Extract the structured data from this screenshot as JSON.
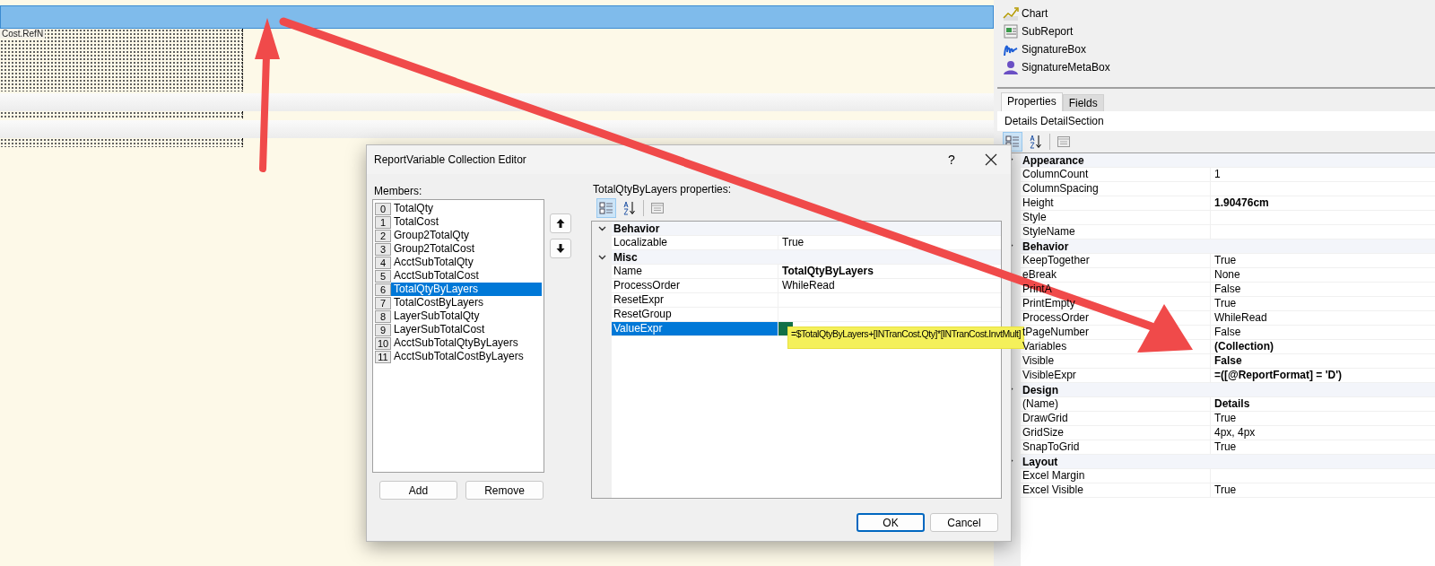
{
  "designer": {
    "sections": [
      {
        "selected": true
      },
      {
        "selected": false
      },
      {
        "selected": false
      }
    ],
    "field_label": "Cost.RefN"
  },
  "toolbox": [
    {
      "label": "Chart",
      "kind": "chart"
    },
    {
      "label": "SubReport",
      "kind": "subreport"
    },
    {
      "label": "SignatureBox",
      "kind": "signature"
    },
    {
      "label": "SignatureMetaBox",
      "kind": "person"
    }
  ],
  "properties_panel": {
    "tabs": [
      {
        "label": "Properties",
        "selected": true
      },
      {
        "label": "Fields",
        "selected": false
      }
    ],
    "object": "Details DetailSection",
    "categories": [
      {
        "name": "Appearance",
        "expanded": true,
        "properties": [
          {
            "name": "ColumnCount",
            "value": "1",
            "bold": false
          },
          {
            "name": "ColumnSpacing"
          },
          {
            "name": "Height",
            "value": "1.90476cm",
            "bold": true
          },
          {
            "name": "Style"
          },
          {
            "name": "StyleName"
          }
        ]
      },
      {
        "name": "Behavior",
        "expanded": true,
        "properties": [
          {
            "name": "KeepTogether",
            "value": "True",
            "bold": false
          },
          {
            "name": "eBreak",
            "value": "None",
            "bold": false
          },
          {
            "name": "PrintA",
            "value": "False",
            "bold": false
          },
          {
            "name": "PrintEmpty",
            "value": "True",
            "bold": false
          },
          {
            "name": "ProcessOrder",
            "value": "WhileRead",
            "bold": false
          },
          {
            "name": "tPageNumber",
            "value": "False",
            "bold": false
          },
          {
            "name": "Variables",
            "value": "(Collection)",
            "bold": true
          },
          {
            "name": "Visible",
            "value": "False",
            "bold": true
          },
          {
            "name": "VisibleExpr",
            "value": "=([@ReportFormat] = 'D')",
            "bold": true
          }
        ]
      },
      {
        "name": "Design",
        "expanded": true,
        "properties": [
          {
            "name": "(Name)",
            "value": "Details",
            "bold": true
          },
          {
            "name": "DrawGrid",
            "value": "True",
            "bold": false
          },
          {
            "name": "GridSize",
            "value": "4px, 4px",
            "bold": false
          },
          {
            "name": "SnapToGrid",
            "value": "True",
            "bold": false
          }
        ]
      },
      {
        "name": "Layout",
        "expanded": true,
        "properties": [
          {
            "name": "Excel Margin"
          },
          {
            "name": "Excel Visible",
            "value": "True",
            "bold": false
          }
        ]
      }
    ]
  },
  "dialog": {
    "title": "ReportVariable Collection Editor",
    "help": "?",
    "members_label": "Members:",
    "members": [
      {
        "index": "0",
        "name": "TotalQty",
        "selected": false
      },
      {
        "index": "1",
        "name": "TotalCost",
        "selected": false
      },
      {
        "index": "2",
        "name": "Group2TotalQty",
        "selected": false
      },
      {
        "index": "3",
        "name": "Group2TotalCost",
        "selected": false
      },
      {
        "index": "4",
        "name": "AcctSubTotalQty",
        "selected": false
      },
      {
        "index": "5",
        "name": "AcctSubTotalCost",
        "selected": false
      },
      {
        "index": "6",
        "name": "TotalQtyByLayers",
        "selected": true
      },
      {
        "index": "7",
        "name": "TotalCostByLayers",
        "selected": false
      },
      {
        "index": "8",
        "name": "LayerSubTotalQty",
        "selected": false
      },
      {
        "index": "9",
        "name": "LayerSubTotalCost",
        "selected": false
      },
      {
        "index": "10",
        "name": "AcctSubTotalQtyByLayers",
        "selected": false
      },
      {
        "index": "11",
        "name": "AcctSubTotalCostByLayers",
        "selected": false
      }
    ],
    "list_buttons": [
      "Add",
      "Remove"
    ],
    "properties_label": "TotalQtyByLayers properties:",
    "categories": [
      {
        "name": "Behavior",
        "expanded": true,
        "properties": [
          {
            "name": "Localizable",
            "value": "True",
            "bold": false,
            "selected": false
          }
        ]
      },
      {
        "name": "Misc",
        "expanded": true,
        "properties": [
          {
            "name": "Name",
            "value": "TotalQtyByLayers",
            "bold": true,
            "selected": false
          },
          {
            "name": "ProcessOrder",
            "value": "WhileRead",
            "bold": false,
            "selected": false
          },
          {
            "name": "ResetExpr",
            "selected": false
          },
          {
            "name": "ResetGroup",
            "selected": false
          },
          {
            "name": "ValueExpr",
            "selected": true
          }
        ]
      }
    ],
    "tooltip": {
      "text": "=$TotalQtyByLayers+[INTranCost.Qty]*[INTranCost.InvtMult]",
      "highlighted": true
    },
    "buttons": [
      {
        "label": "OK",
        "default": true
      },
      {
        "label": "Cancel",
        "default": false
      }
    ]
  }
}
